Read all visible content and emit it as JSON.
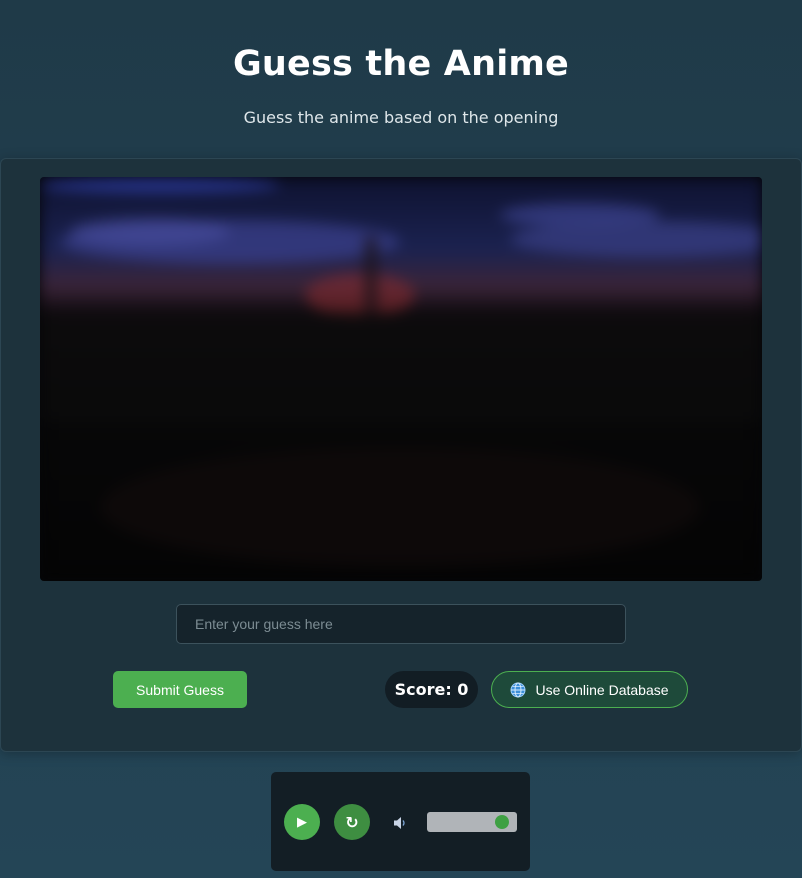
{
  "header": {
    "title": "Guess the Anime",
    "subtitle": "Guess the anime based on the opening"
  },
  "video": {
    "state": "blurred"
  },
  "guess": {
    "placeholder": "Enter your guess here",
    "value": ""
  },
  "controls": {
    "submit_label": "Submit Guess",
    "score_label": "Score: 0",
    "database_label": "Use Online Database",
    "database_icon": "globe-icon"
  },
  "player": {
    "play_icon": "▶",
    "replay_icon": "↻",
    "volume_icon": "speaker-icon",
    "volume_level": 0.9
  },
  "colors": {
    "accent": "#4caf50",
    "background": "#213f4f",
    "panel": "#1d323c"
  }
}
